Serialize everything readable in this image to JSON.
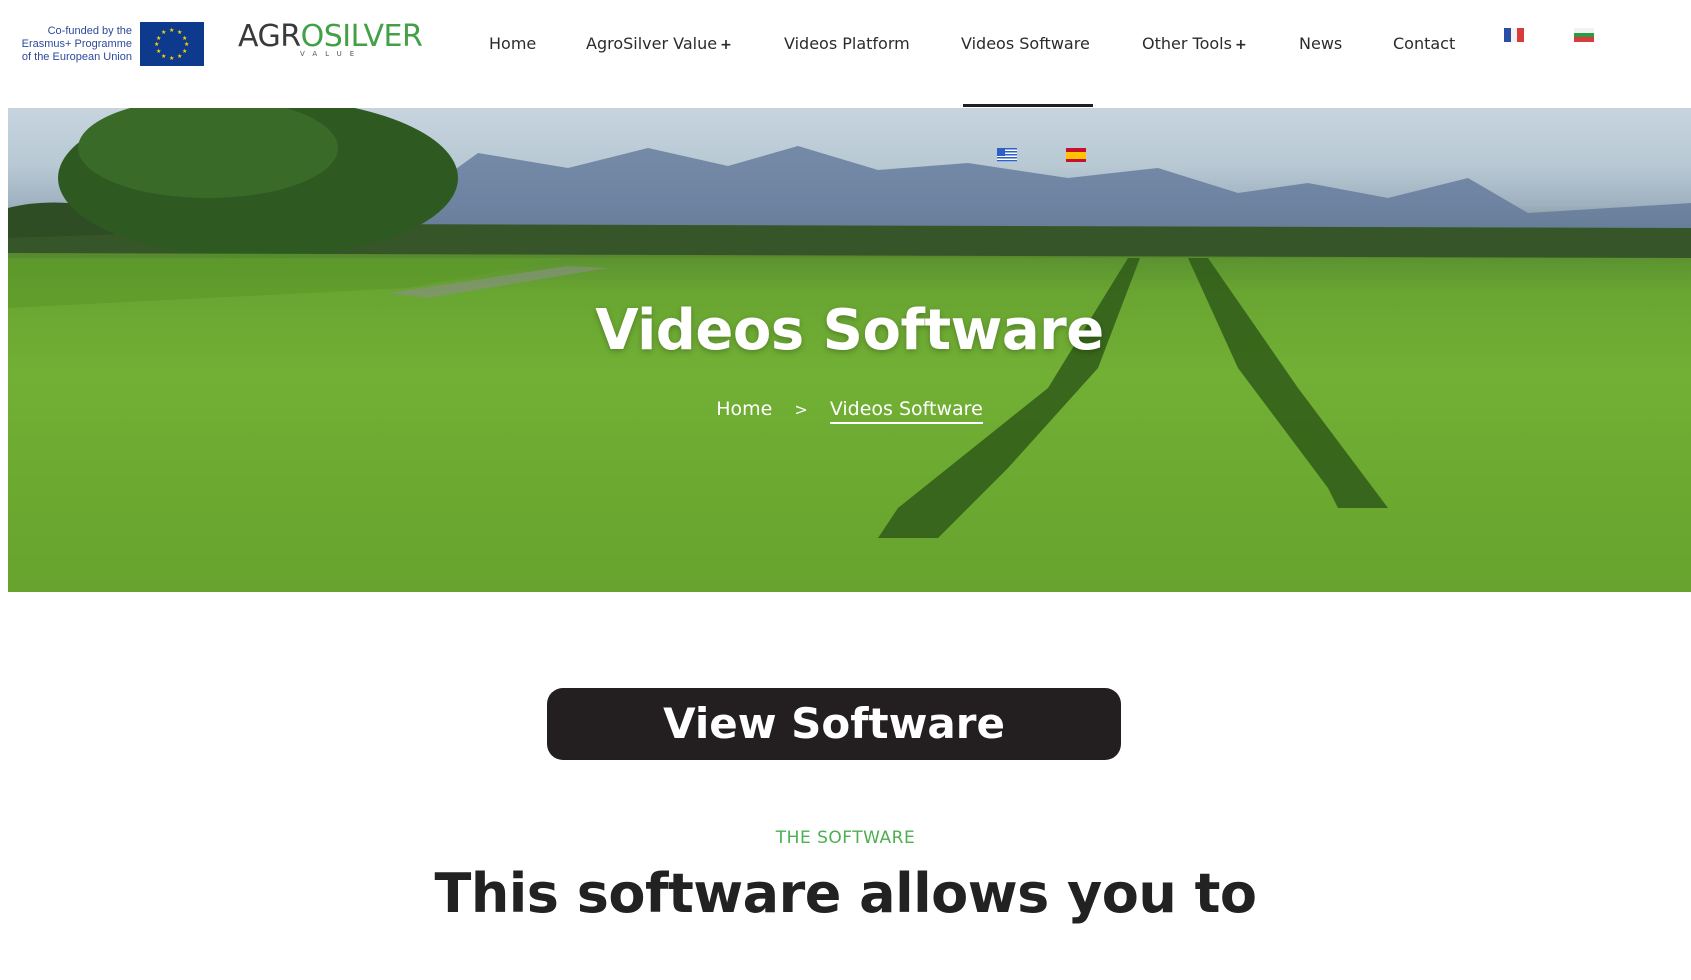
{
  "header": {
    "erasmus_text": "Co-funded by the Erasmus+ Programme of the European Union",
    "logo_main_dark": "AGR",
    "logo_leaf_char": "O",
    "logo_main_green": "SILVER",
    "logo_sub": "VALUE"
  },
  "nav": {
    "items": [
      {
        "label": "Home",
        "has_submenu": false
      },
      {
        "label": "AgroSilver Value",
        "has_submenu": true
      },
      {
        "label": "Videos Platform",
        "has_submenu": false
      },
      {
        "label": "Videos Software",
        "has_submenu": false,
        "active": true
      },
      {
        "label": "Other Tools",
        "has_submenu": true
      },
      {
        "label": "News",
        "has_submenu": false
      },
      {
        "label": "Contact",
        "has_submenu": false
      }
    ],
    "submenu_symbol": "+",
    "languages": [
      "french-flag-icon",
      "bulgarian-flag-icon",
      "greek-flag-icon",
      "spanish-flag-icon"
    ]
  },
  "hero": {
    "title": "Videos Software",
    "breadcrumb_home": "Home",
    "breadcrumb_sep": ">",
    "breadcrumb_current": "Videos Software"
  },
  "content": {
    "button_label": "View Software",
    "eyebrow": "THE SOFTWARE",
    "section_title": "This software allows you to"
  },
  "colors": {
    "accent_green": "#4caf50",
    "button_bg": "#231f20",
    "eu_blue": "#0d3a8c"
  }
}
